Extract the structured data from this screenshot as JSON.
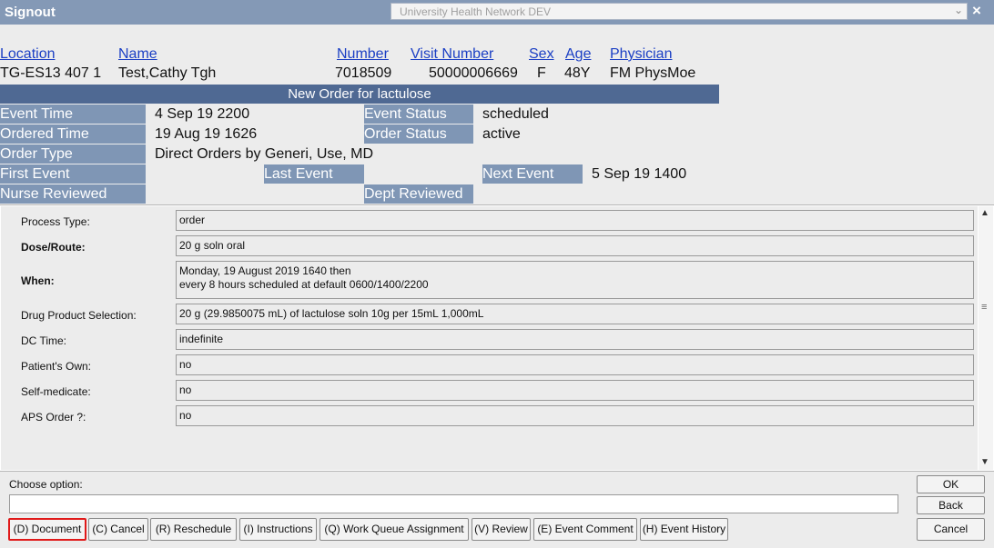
{
  "window": {
    "title": "Signout",
    "close_icon": "×"
  },
  "network_select": {
    "value": "University Health Network DEV"
  },
  "patient_header": {
    "columns": [
      "Location",
      "Name",
      "Number",
      "Visit Number",
      "Sex",
      "Age",
      "Physician"
    ],
    "values": {
      "location": "TG-ES13 407 1",
      "name": "Test,Cathy Tgh",
      "number": "7018509",
      "visit_number": "50000006669",
      "sex": "F",
      "age": "48Y",
      "physician": "FM PhysMoe"
    }
  },
  "order_banner": "New Order for lactulose",
  "event_info": {
    "event_time": {
      "label": "Event Time",
      "value": "4 Sep 19  2200"
    },
    "event_status": {
      "label": "Event Status",
      "value": "scheduled"
    },
    "ordered_time": {
      "label": "Ordered Time",
      "value": "19 Aug 19  1626"
    },
    "order_status": {
      "label": "Order Status",
      "value": "active"
    },
    "order_type": {
      "label": "Order Type",
      "value": "Direct Orders by Generi, Use, MD"
    },
    "first_event": {
      "label": "First Event",
      "value": ""
    },
    "last_event": {
      "label": "Last Event",
      "value": ""
    },
    "next_event": {
      "label": "Next Event",
      "value": "5 Sep 19  1400"
    },
    "nurse_reviewed": {
      "label": "Nurse Reviewed",
      "value": ""
    },
    "dept_reviewed": {
      "label": "Dept Reviewed",
      "value": ""
    }
  },
  "details": {
    "process_type": {
      "label": "Process Type:",
      "value": "order"
    },
    "dose_route": {
      "label": "Dose/Route:",
      "value": "20 g soln oral"
    },
    "when": {
      "label": "When:",
      "line1": "Monday, 19 August 2019  1640 then",
      "line2": "every 8 hours scheduled at default 0600/1400/2200"
    },
    "drug_product": {
      "label": "Drug Product Selection:",
      "value": "20 g (29.9850075 mL) of lactulose soln 10g per 15mL 1,000mL"
    },
    "dc_time": {
      "label": "DC Time:",
      "value": "indefinite"
    },
    "patients_own": {
      "label": "Patient's Own:",
      "value": "no"
    },
    "self_medicate": {
      "label": "Self-medicate:",
      "value": "no"
    },
    "aps_order": {
      "label": "APS Order ?:",
      "value": "no"
    }
  },
  "scrollbar": {
    "up": "▲",
    "down": "▼",
    "grip": "≡"
  },
  "choose": {
    "label": "Choose option:",
    "value": ""
  },
  "actions": [
    "(D) Document",
    "(C) Cancel",
    "(R) Reschedule",
    "(I) Instructions",
    "(Q) Work Queue Assignment",
    "(V) Review",
    "(E) Event Comment",
    "(H) Event History"
  ],
  "side_buttons": {
    "ok": "OK",
    "back": "Back",
    "cancel": "Cancel"
  }
}
